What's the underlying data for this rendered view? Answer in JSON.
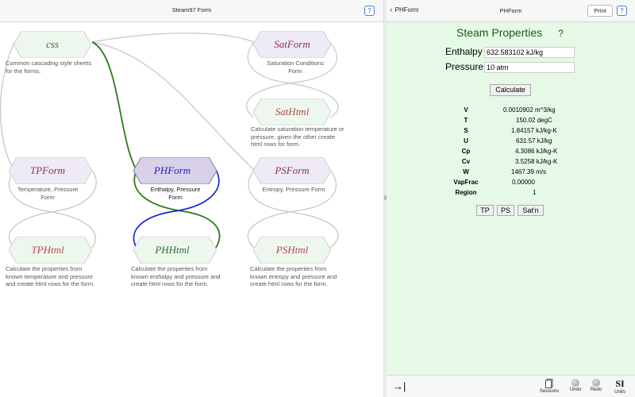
{
  "left": {
    "title": "Steam97 Form",
    "help": "?",
    "nodes": {
      "css": {
        "label": "css"
      },
      "satform": {
        "label": "SatForm"
      },
      "sathtml": {
        "label": "SatHtml"
      },
      "tpform": {
        "label": "TPForm"
      },
      "phform": {
        "label": "PHForm"
      },
      "psform": {
        "label": "PSForm"
      },
      "tphtml": {
        "label": "TPHtml"
      },
      "phhtml": {
        "label": "PHHtml"
      },
      "pshtml": {
        "label": "PSHtml"
      }
    },
    "descs": {
      "css": "Common cascading style sheets for the forms.",
      "satform": "Saturation Conditions Form",
      "sathtml": "Calculate saturation temperature or pressure, given the other create html rows for form.",
      "tpform": "Temperature, Pressure Form",
      "phform": "Enthalpy, Pressure Form",
      "psform": "Entropy, Pressure Form",
      "tphtml": "Calculate the properties from known temperature and pressure and create html rows for the form.",
      "phhtml": "Calculate the properties from known enthalpy and pressure and create html rows for the form.",
      "pshtml": "Calculate the properties from known entropy and pressure and create html rows for the form."
    },
    "colors": {
      "node_fill": "#eeeaf6",
      "node_fill_light": "#eef7ee",
      "node_selected": "#d9d0ea",
      "green_text": "#2e6e2e",
      "purple_text": "#8a2f55",
      "red_text": "#b04a4a",
      "blue_text": "#2222bb",
      "connector_gray": "#c8c8c8",
      "connector_green": "#2a7a1a",
      "connector_blue": "#1a2ad6"
    }
  },
  "right": {
    "back_label": "PHForm",
    "title": "PHForm",
    "print": "Print",
    "help": "?",
    "heading": "Steam Properties",
    "heading_q": "?",
    "enthalpy_label": "Enthalpy",
    "enthalpy_value": "632.583102 kJ/kg",
    "pressure_label": "Pressure",
    "pressure_value": "10 atm",
    "calculate": "Calculate",
    "props": [
      {
        "name": "V",
        "value": "0.0010902 m^3/kg"
      },
      {
        "name": "T",
        "value": "150.02 degC"
      },
      {
        "name": "S",
        "value": "1.84157 kJ/kg-K"
      },
      {
        "name": "U",
        "value": "631.57 kJ/kg"
      },
      {
        "name": "Cp",
        "value": "4.3086 kJ/kg-K"
      },
      {
        "name": "Cv",
        "value": "3.5258 kJ/kg-K"
      },
      {
        "name": "W",
        "value": "1467.39 m/s"
      },
      {
        "name": "VapFrac",
        "value": "0.00000"
      },
      {
        "name": "Region",
        "value": "1"
      }
    ],
    "buttons": {
      "tp": "TP",
      "ps": "PS",
      "satn": "Sat'n"
    },
    "toolbar": {
      "arrow": "→|",
      "sessions": "Sessions",
      "undo": "Undo",
      "redo": "Redo",
      "si": "SI",
      "units": "Units"
    }
  }
}
